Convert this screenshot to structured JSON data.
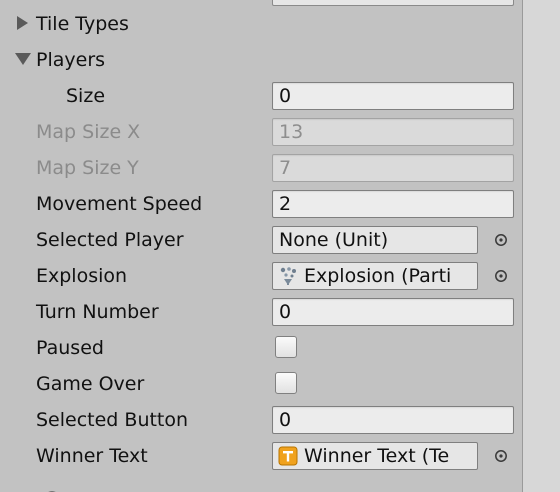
{
  "inspector": {
    "foldouts": {
      "tile_types": "Tile Types",
      "players": "Players"
    },
    "fields": {
      "size": {
        "label": "Size",
        "value": "0"
      },
      "map_size_x": {
        "label": "Map Size X",
        "value": "13"
      },
      "map_size_y": {
        "label": "Map Size Y",
        "value": "7"
      },
      "movement_speed": {
        "label": "Movement Speed",
        "value": "2"
      },
      "selected_player": {
        "label": "Selected Player",
        "value": "None (Unit)"
      },
      "explosion": {
        "label": "Explosion",
        "value": "Explosion (Parti"
      },
      "turn_number": {
        "label": "Turn Number",
        "value": "0"
      },
      "paused": {
        "label": "Paused",
        "checked": false
      },
      "game_over": {
        "label": "Game Over",
        "checked": false
      },
      "selected_button": {
        "label": "Selected Button",
        "value": "0"
      },
      "winner_text": {
        "label": "Winner Text",
        "value": "Winner Text (Te"
      }
    },
    "icons": {
      "foldout_collapsed": "triangle-right-icon",
      "foldout_expanded": "triangle-down-icon",
      "object_picker": "target-circle-icon",
      "particle_system": "particle-system-icon",
      "text_component": "text-component-icon"
    },
    "colors": {
      "panel_bg": "#c2c2c2",
      "field_bg": "#ececec",
      "disabled_text": "#8b8b8b",
      "text_icon_orange": "#f0a21e"
    }
  }
}
